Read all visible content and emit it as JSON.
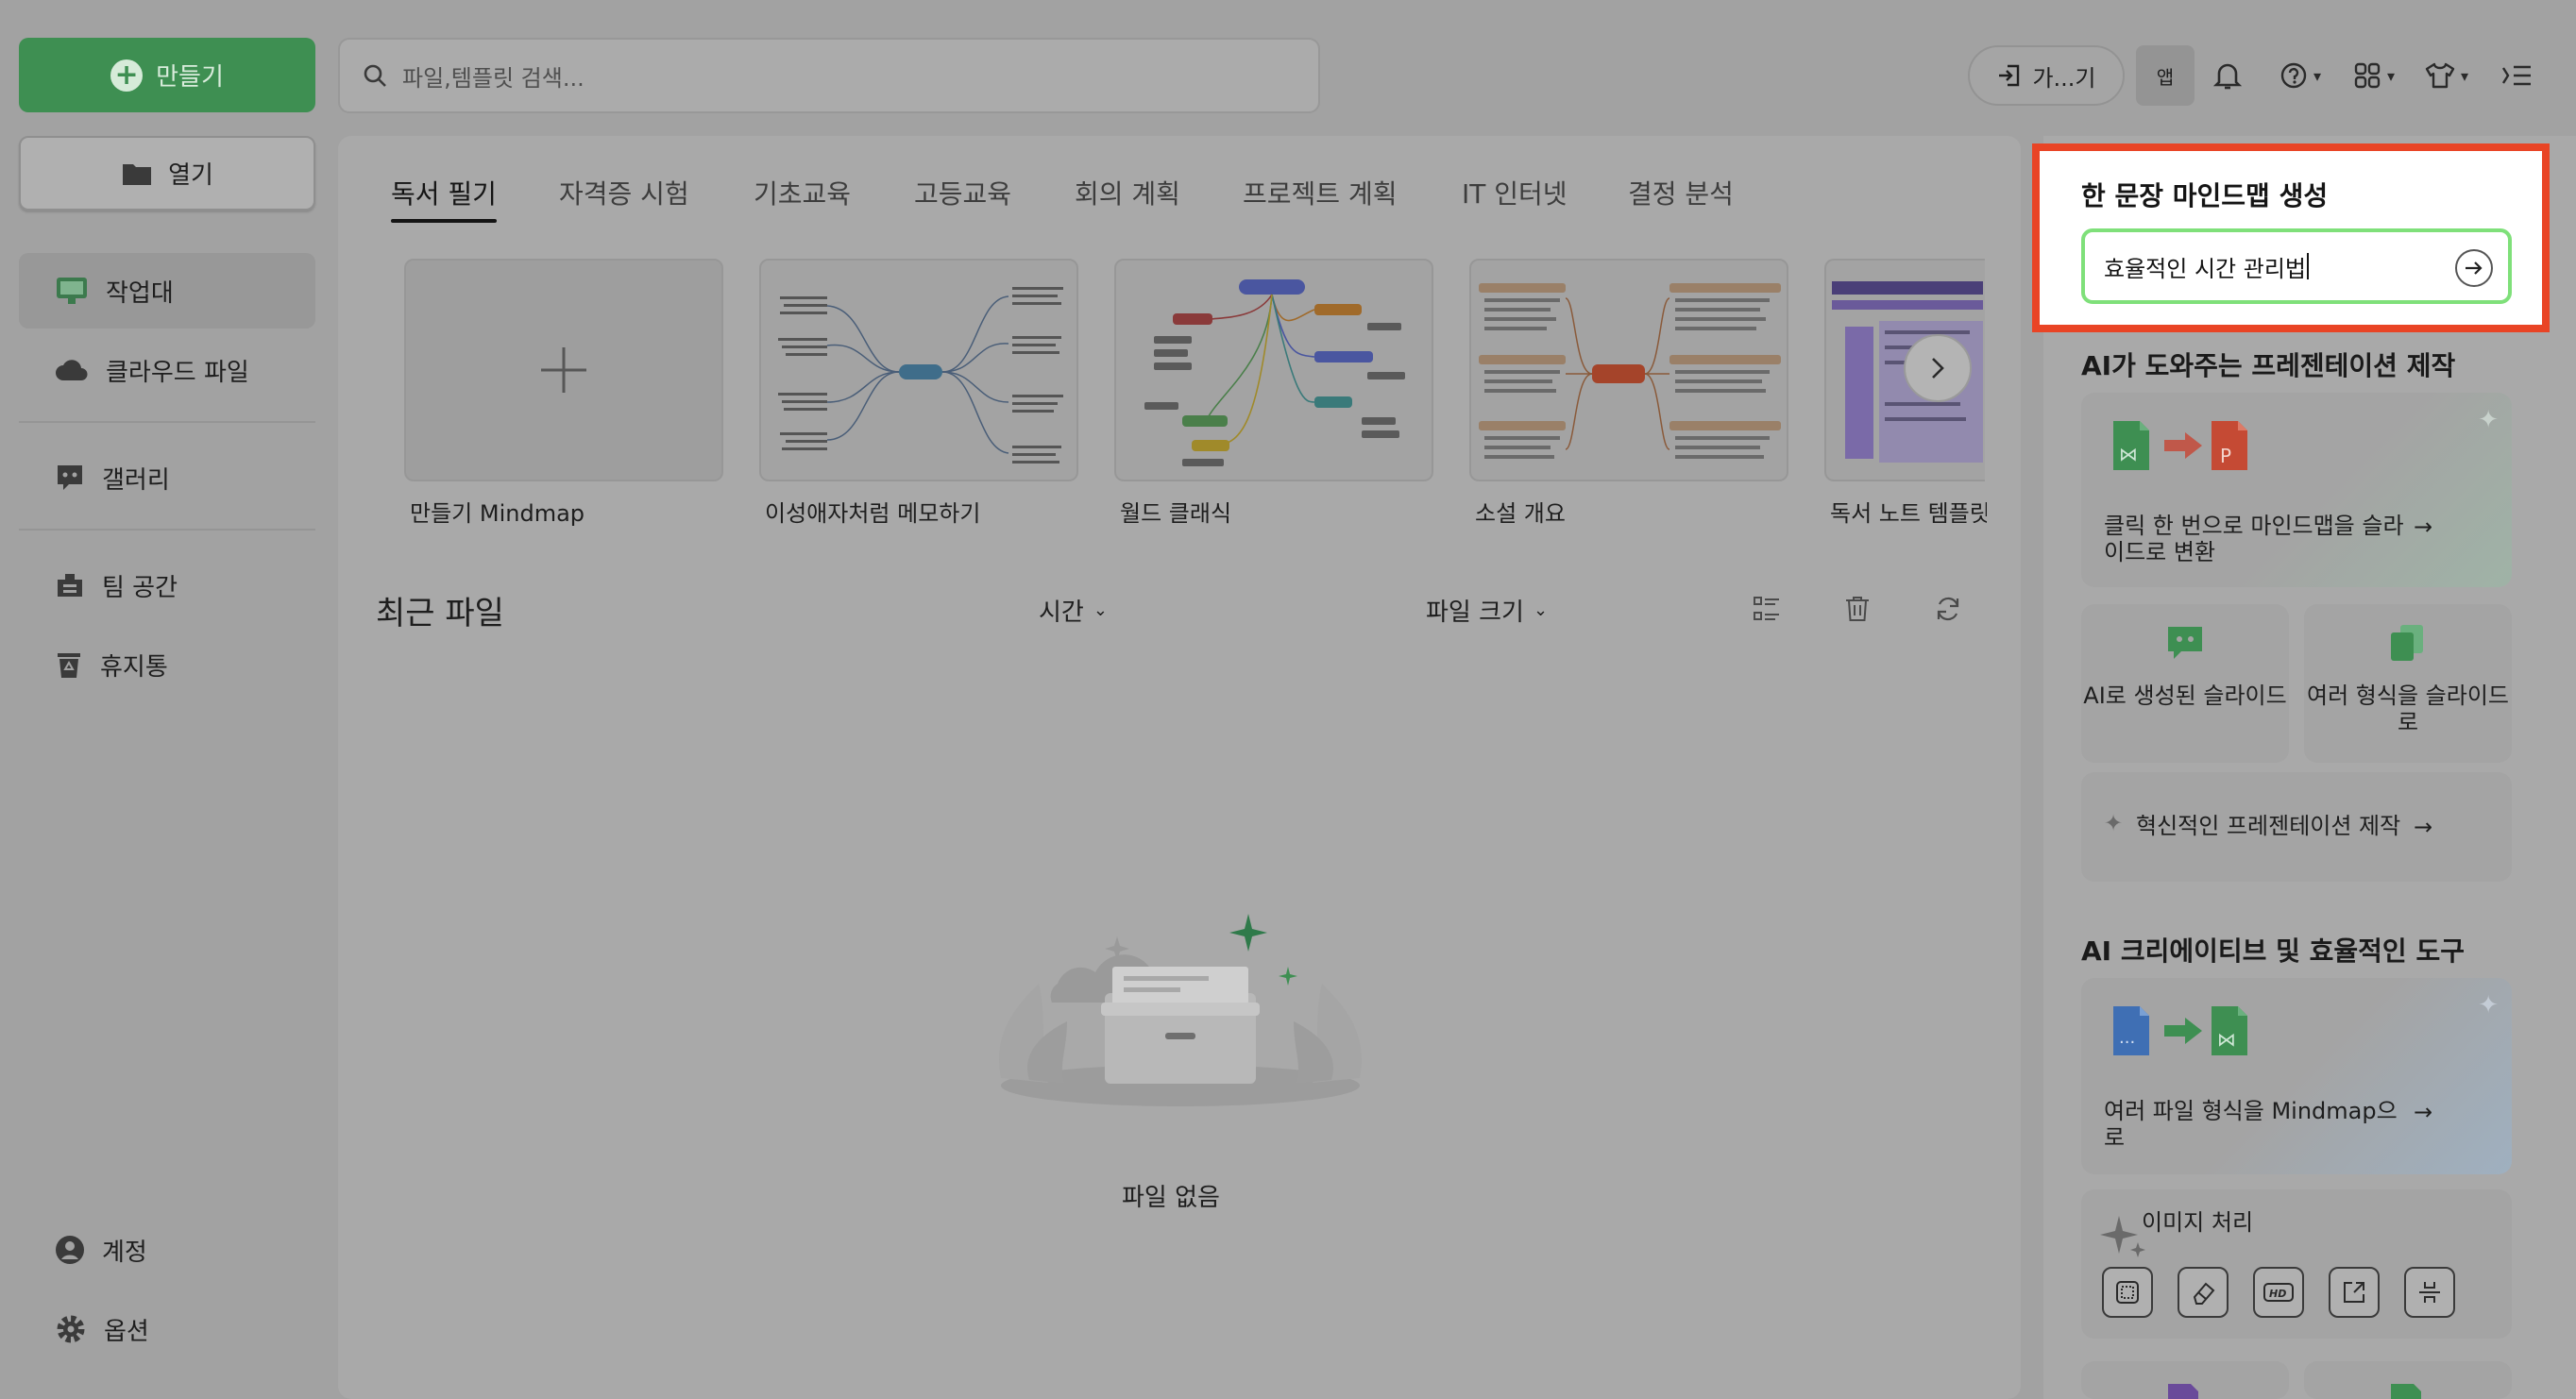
{
  "sidebar": {
    "create_label": "만들기",
    "open_label": "열기",
    "items": [
      {
        "label": "작업대"
      },
      {
        "label": "클라우드 파일"
      },
      {
        "label": "갤러리"
      },
      {
        "label": "팀 공간"
      },
      {
        "label": "휴지통"
      },
      {
        "label": "계정"
      },
      {
        "label": "옵션"
      }
    ]
  },
  "header": {
    "search_placeholder": "파일,템플릿 검색...",
    "join_label": "가...기",
    "app_label": "앱"
  },
  "tabs": [
    {
      "label": "독서 필기"
    },
    {
      "label": "자격증 시험"
    },
    {
      "label": "기초교육"
    },
    {
      "label": "고등교육"
    },
    {
      "label": "회의 계획"
    },
    {
      "label": "프로젝트 계획"
    },
    {
      "label": "IT 인터넷"
    },
    {
      "label": "결정 분석"
    }
  ],
  "templates": [
    {
      "label": "만들기 Mindmap"
    },
    {
      "label": "이성애자처럼 메모하기"
    },
    {
      "label": "월드 클래식"
    },
    {
      "label": "소설 개요"
    },
    {
      "label": "독서 노트 템플릿"
    }
  ],
  "recent": {
    "title": "최근 파일",
    "sort_time": "시간",
    "sort_size": "파일 크기",
    "empty": "파일 없음"
  },
  "right": {
    "oneline_title": "한 문장 마인드맵 생성",
    "oneline_value": "효율적인 시간 관리법",
    "ppt_title": "AI가 도와주는 프레젠테이션 제작",
    "ppt_card": "클릭 한 번으로 마인드맵을 슬라이드로 변환",
    "ai_slides": "AI로 생성된 슬라이드",
    "multi_format": "여러 형식을 슬라이드로",
    "innovative": "혁신적인 프레젠테이션 제작",
    "tools_title": "AI 크리에이티브 및 효율적인 도구",
    "convert_card": "여러 파일 형식을 Mindmap으로",
    "image_title": "이미지 처리"
  },
  "colors": {
    "accent_green": "#3e8f52",
    "highlight_red": "#e94425",
    "input_border": "#7fe07a"
  }
}
